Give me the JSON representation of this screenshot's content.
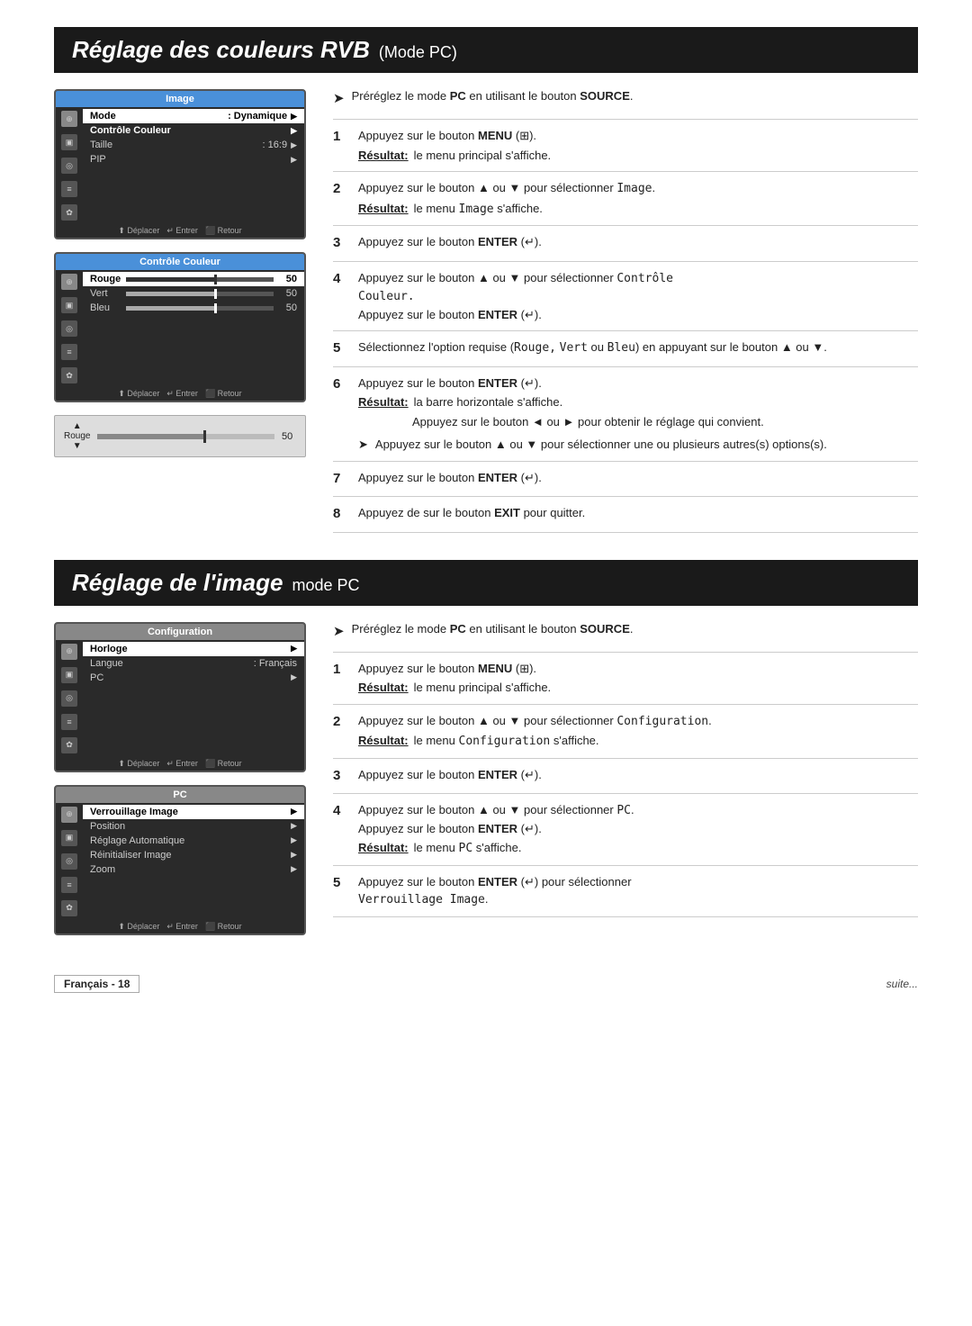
{
  "section1": {
    "title_main": "Réglage des couleurs RVB",
    "title_sub": "(Mode PC)",
    "prereq": "Préréglez le mode PC en utilisant le bouton SOURCE.",
    "prereq_bold": "PC",
    "prereq_bold2": "SOURCE",
    "steps": [
      {
        "num": "1",
        "text_before": "Appuyez sur le bouton ",
        "bold1": "MENU",
        "bold1_after": " (   ).",
        "result_label": "Résultat:",
        "result_text": "le menu principal s'affiche."
      },
      {
        "num": "2",
        "text_before": "Appuyez sur le bouton ▲ ou ▼ pour sélectionner ",
        "code1": "Image",
        "text_after": ".",
        "result_label": "Résultat:",
        "result_text": "le menu Image s'affiche."
      },
      {
        "num": "3",
        "text_before": "Appuyez sur le bouton ",
        "bold1": "ENTER",
        "bold1_after": " (↵)."
      },
      {
        "num": "4",
        "text_before": "Appuyez sur le bouton ▲ ou ▼ pour sélectionner ",
        "code1": "Contrôle",
        "code2": "Couleur.",
        "text_after": "\nAppuyez sur le bouton ",
        "bold1": "ENTER",
        "bold1_after": " (↵)."
      },
      {
        "num": "5",
        "text_before": "Sélectionnez l'option requise (",
        "code1": "Rouge,",
        "code2": " Vert",
        "code3": " ou ",
        "code4": "Bleu",
        "text_after": ") en appuyant sur le bouton ▲ ou ▼."
      },
      {
        "num": "6",
        "text_before": "Appuyez sur le bouton ",
        "bold1": "ENTER",
        "bold1_after": " (↵).",
        "result_label": "Résultat:",
        "result_text": "la barre horizontale s'affiche.",
        "sub_text": "Appuyez sur le bouton ◄ ou ► pour obtenir le réglage qui convient.",
        "arrow_text": "Appuyez sur le bouton ▲ ou ▼ pour sélectionner une ou plusieurs autres(s) options(s)."
      },
      {
        "num": "7",
        "text_before": "Appuyez sur le bouton ",
        "bold1": "ENTER",
        "bold1_after": " (↵)."
      },
      {
        "num": "8",
        "text_before": "Appuyez de sur le bouton ",
        "bold1": "EXIT",
        "bold1_after": " pour quitter."
      }
    ],
    "screen1": {
      "title": "Image",
      "items": [
        {
          "label": "Mode",
          "value": ": Dynamique",
          "arrow": true,
          "hl": false
        },
        {
          "label": "Contrôle Couleur",
          "value": "",
          "arrow": true,
          "hl": true
        },
        {
          "label": "Taille",
          "value": ": 16:9",
          "arrow": true,
          "hl": false
        },
        {
          "label": "PIP",
          "value": "",
          "arrow": true,
          "hl": false
        }
      ],
      "footer": "⬆ Déplacer  ↵ Entrer  ⬛ Retour"
    },
    "screen2": {
      "title": "Contrôle Couleur",
      "items": [
        {
          "label": "Rouge",
          "val": "50",
          "hl": true
        },
        {
          "label": "Vert",
          "val": "50",
          "hl": false
        },
        {
          "label": "Bleu",
          "val": "50",
          "hl": false
        }
      ],
      "footer": "⬆ Déplacer  ↵ Entrer  ⬛ Retour"
    },
    "screen3": {
      "label": "Rouge",
      "val": "50"
    }
  },
  "section2": {
    "title_main": "Réglage de l'image",
    "title_sub": "mode PC",
    "prereq": "Préréglez le mode PC en utilisant le bouton SOURCE.",
    "prereq_bold": "PC",
    "prereq_bold2": "SOURCE",
    "steps": [
      {
        "num": "1",
        "text_before": "Appuyez sur le bouton ",
        "bold1": "MENU",
        "bold1_after": " (   ).",
        "result_label": "Résultat:",
        "result_text": "le menu principal s'affiche."
      },
      {
        "num": "2",
        "text_before": "Appuyez sur le bouton ▲ ou ▼ pour sélectionner ",
        "code1": "Configuration",
        "text_after": ".",
        "result_label": "Résultat:",
        "result_text": "le menu Configuration s'affiche."
      },
      {
        "num": "3",
        "text_before": "Appuyez sur le bouton ",
        "bold1": "ENTER",
        "bold1_after": " (↵)."
      },
      {
        "num": "4",
        "text_before": "Appuyez sur le bouton ▲ ou ▼ pour sélectionner ",
        "code1": "PC",
        "text_after": ".\nAppuyez sur le bouton ",
        "bold1": "ENTER",
        "bold1_after": " (↵).",
        "result_label": "Résultat:",
        "result_text": "le menu PC s'affiche."
      },
      {
        "num": "5",
        "text_before": "Appuyez sur le bouton ",
        "bold1": "ENTER",
        "bold1_after": " (↵) pour sélectionner\nVerrouillage Image.",
        "code1": "Verrouillage Image"
      }
    ],
    "screen1": {
      "title": "Configuration",
      "items": [
        {
          "label": "Horloge",
          "hl": true,
          "arrow": true
        },
        {
          "label": "Langue",
          "value": ": Français",
          "hl": false,
          "arrow": false
        },
        {
          "label": "PC",
          "hl": false,
          "arrow": true
        }
      ],
      "footer": "⬆ Déplacer  ↵ Entrer  ⬛ Retour"
    },
    "screen2": {
      "title": "PC",
      "items": [
        {
          "label": "Verrouillage Image",
          "hl": true,
          "arrow": true
        },
        {
          "label": "Position",
          "hl": false,
          "arrow": true
        },
        {
          "label": "Réglage Automatique",
          "hl": false,
          "arrow": true
        },
        {
          "label": "Réinitialiser Image",
          "hl": false,
          "arrow": true
        },
        {
          "label": "Zoom",
          "hl": false,
          "arrow": true
        }
      ],
      "footer": "⬆ Déplacer  ↵ Entrer  ⬛ Retour"
    }
  },
  "footer": {
    "page": "Français - 18",
    "suite": "suite..."
  }
}
